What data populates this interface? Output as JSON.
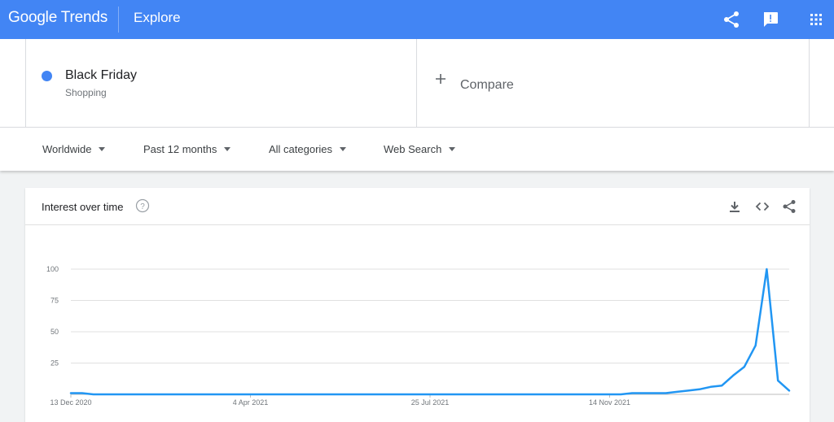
{
  "header": {
    "logo": "Google Trends",
    "section": "Explore",
    "icons": [
      "share-icon",
      "feedback-icon",
      "apps-icon"
    ]
  },
  "search_term": {
    "name": "Black Friday",
    "category": "Shopping",
    "color": "#4285f4"
  },
  "compare": {
    "label": "Compare"
  },
  "filters": {
    "region": "Worldwide",
    "period": "Past 12 months",
    "category": "All categories",
    "property": "Web Search"
  },
  "card": {
    "title": "Interest over time",
    "icons": [
      "help-icon",
      "download-icon",
      "embed-icon",
      "share-icon"
    ]
  },
  "chart_data": {
    "type": "line",
    "title": "",
    "xlabel": "",
    "ylabel": "",
    "ylim": [
      0,
      100
    ],
    "yticks": [
      25,
      50,
      75,
      100
    ],
    "xtick_labels": [
      "13 Dec 2020",
      "4 Apr 2021",
      "25 Jul 2021",
      "14 Nov 2021"
    ],
    "grid": true,
    "color": "#2196f3",
    "series": [
      {
        "values": [
          1,
          1,
          0,
          0,
          0,
          0,
          0,
          0,
          0,
          0,
          0,
          0,
          0,
          0,
          0,
          0,
          0,
          0,
          0,
          0,
          0,
          0,
          0,
          0,
          0,
          0,
          0,
          0,
          0,
          0,
          0,
          0,
          0,
          0,
          0,
          0,
          0,
          0,
          0,
          0,
          0,
          0,
          0,
          0,
          0,
          0,
          0,
          0,
          0,
          0,
          1,
          1,
          1,
          1,
          2,
          3,
          4,
          6,
          7,
          15,
          22,
          39,
          100,
          11,
          3
        ]
      }
    ]
  }
}
